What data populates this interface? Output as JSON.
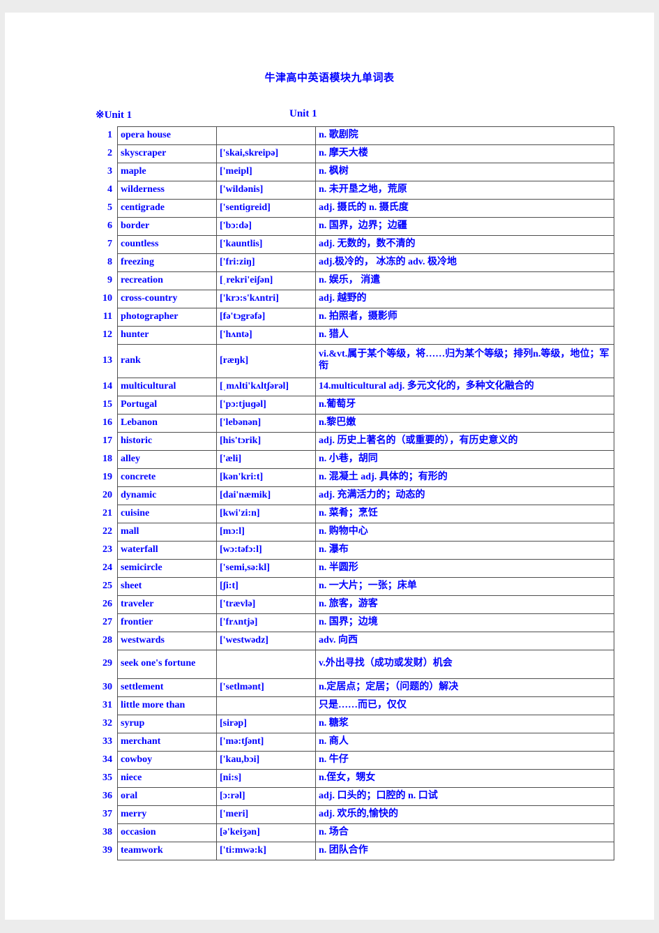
{
  "document": {
    "title": "牛津高中英语模块九单词表",
    "unit_header_left": "※Unit 1",
    "unit_header_right": "Unit  1",
    "text_color": "#0000ff",
    "border_color": "#4d4d4d"
  },
  "table": {
    "rows": [
      {
        "num": "1",
        "word": "opera house",
        "ipa": "",
        "def": "n. 歌剧院"
      },
      {
        "num": "2",
        "word": "skyscraper",
        "ipa": "['skai,skreipə]",
        "def": "n. 摩天大楼"
      },
      {
        "num": "3",
        "word": "maple",
        "ipa": "['meipl]",
        "def": "n. 枫树"
      },
      {
        "num": "4",
        "word": "wilderness",
        "ipa": "['wildənis]",
        "def": "n. 未开垦之地，荒原"
      },
      {
        "num": "5",
        "word": "centigrade",
        "ipa": "['sentiɡreid]",
        "def": "adj. 摄氏的 n. 摄氏度"
      },
      {
        "num": "6",
        "word": "border",
        "ipa": "['bɔ:də]",
        "def": "n. 国界，边界；边疆"
      },
      {
        "num": "7",
        "word": "countless",
        "ipa": "['kauntlis]",
        "def": "adj. 无数的，数不清的"
      },
      {
        "num": "8",
        "word": "freezing",
        "ipa": "['fri:ziŋ]",
        "def": "adj.极冷的， 冰冻的 adv. 极冷地"
      },
      {
        "num": "9",
        "word": "recreation",
        "ipa": "[ˌrekri'eiʃən]",
        "def": "n. 娱乐， 消遣"
      },
      {
        "num": "10",
        "word": "cross-country",
        "ipa": "['krɔ:s'kʌntri]",
        "def": "adj. 越野的"
      },
      {
        "num": "11",
        "word": "photographer",
        "ipa": "[fə'tɔgrəfə]",
        "def": "n. 拍照者，摄影师"
      },
      {
        "num": "12",
        "word": "hunter",
        "ipa": "['hʌntə]",
        "def": "n. 猎人"
      },
      {
        "num": "13",
        "word": "rank",
        "ipa": "[ræŋk]",
        "def": "vi.&vt.属于某个等级，将……归为某个等级；排列n.等级，地位；军衔",
        "tall": true
      },
      {
        "num": "14",
        "word": "multicultural",
        "ipa": "[ˌmʌlti'kʌltʃərəl]",
        "def": "14.multicultural adj. 多元文化的，多种文化融合的"
      },
      {
        "num": "15",
        "word": "Portugal",
        "ipa": "['pɔ:tjuɡəl]",
        "def": "n.葡萄牙"
      },
      {
        "num": "16",
        "word": "Lebanon",
        "ipa": "['lebənən]",
        "def": "n.黎巴嫩"
      },
      {
        "num": "17",
        "word": "historic",
        "ipa": "[his'tɔrik]",
        "def": "adj. 历史上著名的（或重要的），有历史意义的"
      },
      {
        "num": "18",
        "word": "alley",
        "ipa": "['æli]",
        "def": "n. 小巷，胡同"
      },
      {
        "num": "19",
        "word": "concrete",
        "ipa": "[kən'kri:t]",
        "def": "n. 混凝土 adj. 具体的；有形的"
      },
      {
        "num": "20",
        "word": "dynamic",
        "ipa": "[dai'næmik]",
        "def": "adj. 充满活力的；动态的"
      },
      {
        "num": "21",
        "word": "cuisine",
        "ipa": "[kwi'zi:n]",
        "def": "n. 菜肴；烹饪"
      },
      {
        "num": "22",
        "word": "mall",
        "ipa": "[mɔ:l]",
        "def": "n. 购物中心"
      },
      {
        "num": "23",
        "word": "waterfall",
        "ipa": "[wɔ:təfɔ:l]",
        "def": "n. 瀑布"
      },
      {
        "num": "24",
        "word": "semicircle",
        "ipa": "['semi,sə:kl]",
        "def": "n. 半圆形"
      },
      {
        "num": "25",
        "word": "sheet",
        "ipa": "[ʃi:t]",
        "def": "n. 一大片；一张；床单"
      },
      {
        "num": "26",
        "word": "traveler",
        "ipa": "['trævlə]",
        "def": "n. 旅客，游客"
      },
      {
        "num": "27",
        "word": "frontier",
        "ipa": "['frʌntjə]",
        "def": "n. 国界；边境"
      },
      {
        "num": "28",
        "word": "westwards",
        "ipa": "['westwədz]",
        "def": "adv. 向西"
      },
      {
        "num": "29",
        "word": "seek one's fortune",
        "ipa": "",
        "def": "v.外出寻找（成功或发财）机会",
        "tall2": true
      },
      {
        "num": "30",
        "word": "settlement",
        "ipa": "['setlmənt]",
        "def": "n.定居点；定居；（问题的）解决"
      },
      {
        "num": "31",
        "word": "little more than",
        "ipa": "",
        "def": "只是……而已，仅仅"
      },
      {
        "num": "32",
        "word": "syrup",
        "ipa": "[sirəp]",
        "def": "n. 糖浆"
      },
      {
        "num": "33",
        "word": "merchant",
        "ipa": "['mə:tʃənt]",
        "def": "n. 商人"
      },
      {
        "num": "34",
        "word": "cowboy",
        "ipa": "['kau,bɔi]",
        "def": "n. 牛仔"
      },
      {
        "num": "35",
        "word": "niece",
        "ipa": "[ni:s]",
        "def": "n.侄女，甥女"
      },
      {
        "num": "36",
        "word": "oral",
        "ipa": "[ɔ:rəl]",
        "def": "adj. 口头的；口腔的 n. 口试"
      },
      {
        "num": "37",
        "word": "merry",
        "ipa": "['meri]",
        "def": "adj. 欢乐的,愉快的"
      },
      {
        "num": "38",
        "word": "occasion",
        "ipa": "[ə'keiʒən]",
        "def": "n. 场合"
      },
      {
        "num": "39",
        "word": "teamwork",
        "ipa": "['ti:mwə:k]",
        "def": "n. 团队合作"
      }
    ]
  }
}
